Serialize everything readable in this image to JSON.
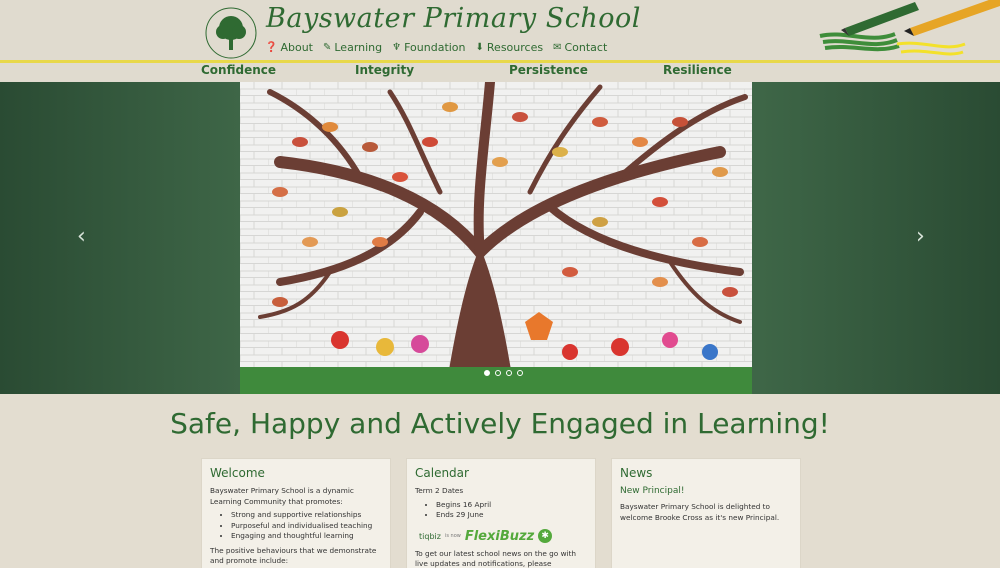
{
  "header": {
    "title": "Bayswater Primary School",
    "logo_text": "BAYSWATER PRIMARY SCHOOL",
    "logo_motto": "OUR HERITAGE OUR FUTURE",
    "nav": [
      {
        "label": "About",
        "icon": "question-circle-icon"
      },
      {
        "label": "Learning",
        "icon": "pencil-icon"
      },
      {
        "label": "Foundation",
        "icon": "seedling-icon"
      },
      {
        "label": "Resources",
        "icon": "download-icon"
      },
      {
        "label": "Contact",
        "icon": "envelope-icon"
      }
    ]
  },
  "values": [
    "Confidence",
    "Integrity",
    "Persistence",
    "Resilience"
  ],
  "carousel": {
    "prev": "‹",
    "next": "›",
    "slides_count": 4,
    "active_index": 0
  },
  "tagline": "Safe, Happy and Actively Engaged in Learning!",
  "panels": {
    "welcome": {
      "title": "Welcome",
      "intro": "Bayswater Primary School is a dynamic Learning Community that promotes:",
      "items": [
        "Strong and supportive relationships",
        "Purposeful and individualised teaching",
        "Engaging and thoughtful learning"
      ],
      "outro": "The positive behaviours that we demonstrate and promote include:"
    },
    "calendar": {
      "title": "Calendar",
      "subtitle": "Term 2 Dates",
      "items": [
        "Begins 16 April",
        "Ends 29 June"
      ],
      "tiqbiz": "tiqbiz",
      "is_now": "is now",
      "flexibuzz": "FlexiBuzz",
      "text": "To get our latest school news on the go with live updates and notifications, please download the FREE"
    },
    "news": {
      "title": "News",
      "headline": "New Principal!",
      "text": "Bayswater Primary School is delighted to welcome Brooke Cross as it's new Principal."
    }
  },
  "colors": {
    "brand_green": "#2f6a32",
    "background": "#e3ddd0",
    "carousel_bg": "#3e6647",
    "accent_yellow": "#e8d84a"
  }
}
